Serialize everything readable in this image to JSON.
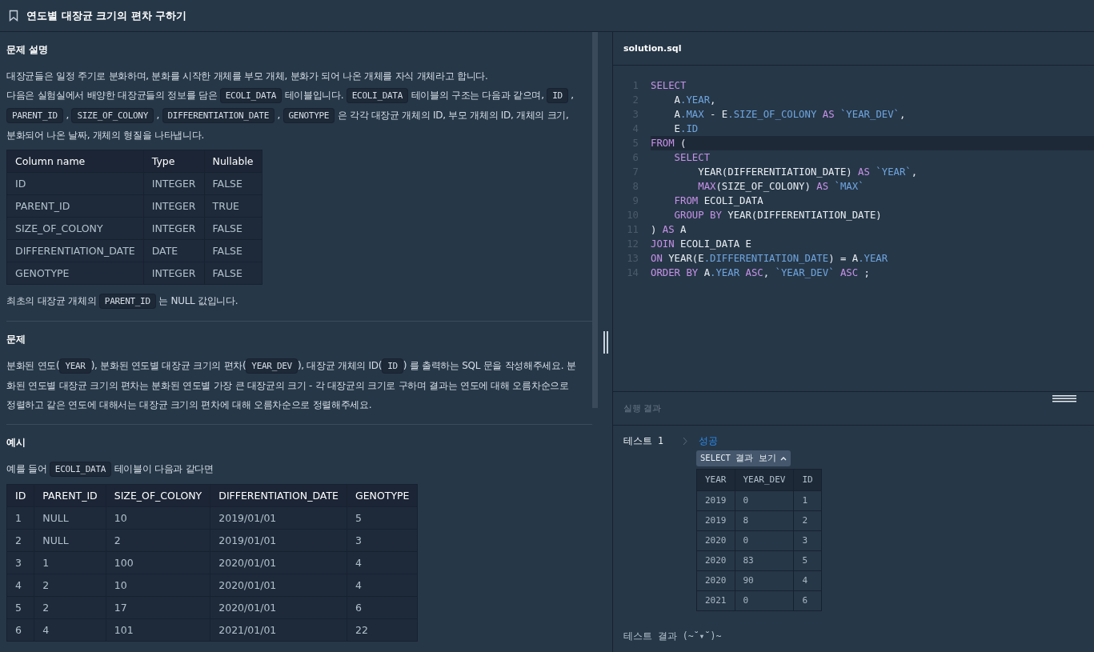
{
  "title": "연도별 대장균 크기의 편차 구하기",
  "description": {
    "heading": "문제 설명",
    "paragraphs": [
      [
        {
          "kind": "text",
          "t": "대장균들은 일정 주기로 분화하며, 분화를 시작한 개체를 부모 개체, 분화가 되어 나온 개체를 자식 개체라고 합니다."
        }
      ],
      [
        {
          "kind": "text",
          "t": "다음은 실험실에서 배양한 대장균들의 정보를 담은 "
        },
        {
          "kind": "code",
          "t": "ECOLI_DATA"
        },
        {
          "kind": "text",
          "t": " 테이블입니다. "
        },
        {
          "kind": "code",
          "t": "ECOLI_DATA"
        },
        {
          "kind": "text",
          "t": " 테이블의 구조는 다음과 같으며, "
        },
        {
          "kind": "code",
          "t": "ID"
        },
        {
          "kind": "text",
          "t": " , "
        },
        {
          "kind": "code",
          "t": "PARENT_ID"
        },
        {
          "kind": "text",
          "t": " , "
        },
        {
          "kind": "code",
          "t": "SIZE_OF_COLONY"
        },
        {
          "kind": "text",
          "t": " , "
        },
        {
          "kind": "code",
          "t": "DIFFERENTIATION_DATE"
        },
        {
          "kind": "text",
          "t": " , "
        },
        {
          "kind": "code",
          "t": "GENOTYPE"
        },
        {
          "kind": "text",
          "t": " 은 각각 대장균 개체의 ID, 부모 개체의 ID, 개체의 크기, 분화되어 나온 날짜, 개체의 형질을 나타냅니다."
        }
      ]
    ],
    "table": {
      "columns": [
        "Column name",
        "Type",
        "Nullable"
      ],
      "rows": [
        [
          "ID",
          "INTEGER",
          "FALSE"
        ],
        [
          "PARENT_ID",
          "INTEGER",
          "TRUE"
        ],
        [
          "SIZE_OF_COLONY",
          "INTEGER",
          "FALSE"
        ],
        [
          "DIFFERENTIATION_DATE",
          "DATE",
          "FALSE"
        ],
        [
          "GENOTYPE",
          "INTEGER",
          "FALSE"
        ]
      ]
    },
    "note": [
      {
        "kind": "text",
        "t": "최초의 대장균 개체의 "
      },
      {
        "kind": "code",
        "t": "PARENT_ID"
      },
      {
        "kind": "text",
        "t": " 는 NULL 값입니다."
      }
    ]
  },
  "problem": {
    "heading": "문제",
    "paragraph": [
      {
        "kind": "text",
        "t": "분화된 연도("
      },
      {
        "kind": "code",
        "t": "YEAR"
      },
      {
        "kind": "text",
        "t": "), 분화된 연도별 대장균 크기의 편차("
      },
      {
        "kind": "code",
        "t": "YEAR_DEV"
      },
      {
        "kind": "text",
        "t": "), 대장균 개체의 ID("
      },
      {
        "kind": "code",
        "t": "ID"
      },
      {
        "kind": "text",
        "t": ") 를 출력하는 SQL 문을 작성해주세요. 분화된 연도별 대장균 크기의 편차는 분화된 연도별 가장 큰 대장균의 크기 - 각 대장균의 크기로 구하며 결과는 연도에 대해 오름차순으로 정렬하고 같은 연도에 대해서는 대장균 크기의 편차에 대해 오름차순으로 정렬해주세요."
      }
    ]
  },
  "example": {
    "heading": "예시",
    "intro": [
      {
        "kind": "text",
        "t": "예를 들어 "
      },
      {
        "kind": "code",
        "t": "ECOLI_DATA"
      },
      {
        "kind": "text",
        "t": " 테이블이 다음과 같다면"
      }
    ],
    "table": {
      "columns": [
        "ID",
        "PARENT_ID",
        "SIZE_OF_COLONY",
        "DIFFERENTIATION_DATE",
        "GENOTYPE"
      ],
      "rows": [
        [
          "1",
          "NULL",
          "10",
          "2019/01/01",
          "5"
        ],
        [
          "2",
          "NULL",
          "2",
          "2019/01/01",
          "3"
        ],
        [
          "3",
          "1",
          "100",
          "2020/01/01",
          "4"
        ],
        [
          "4",
          "2",
          "10",
          "2020/01/01",
          "4"
        ],
        [
          "5",
          "2",
          "17",
          "2020/01/01",
          "6"
        ],
        [
          "6",
          "4",
          "101",
          "2021/01/01",
          "22"
        ]
      ]
    }
  },
  "editor": {
    "filename": "solution.sql",
    "lines": [
      {
        "n": "1",
        "selected": false,
        "tokens": [
          {
            "kind": "kw",
            "t": "SELECT"
          }
        ]
      },
      {
        "n": "2",
        "selected": false,
        "tokens": [
          {
            "kind": "id",
            "t": "    A"
          },
          {
            "kind": "prop",
            "t": ".YEAR"
          },
          {
            "kind": "id",
            "t": ","
          }
        ]
      },
      {
        "n": "3",
        "selected": false,
        "tokens": [
          {
            "kind": "id",
            "t": "    A"
          },
          {
            "kind": "prop",
            "t": ".MAX"
          },
          {
            "kind": "id",
            "t": " - E"
          },
          {
            "kind": "prop",
            "t": ".SIZE_OF_COLONY"
          },
          {
            "kind": "kw",
            "t": " AS"
          },
          {
            "kind": "prop",
            "t": " `YEAR_DEV`"
          },
          {
            "kind": "id",
            "t": ","
          }
        ]
      },
      {
        "n": "4",
        "selected": false,
        "tokens": [
          {
            "kind": "id",
            "t": "    E"
          },
          {
            "kind": "prop",
            "t": ".ID"
          }
        ]
      },
      {
        "n": "5",
        "selected": true,
        "tokens": [
          {
            "kind": "kw",
            "t": "FROM"
          },
          {
            "kind": "id",
            "t": " ("
          }
        ]
      },
      {
        "n": "6",
        "selected": false,
        "tokens": [
          {
            "kind": "kw",
            "t": "    SELECT"
          }
        ]
      },
      {
        "n": "7",
        "selected": false,
        "tokens": [
          {
            "kind": "id",
            "t": "        YEAR(DIFFERENTIATION_DATE)"
          },
          {
            "kind": "kw",
            "t": " AS"
          },
          {
            "kind": "prop",
            "t": " `YEAR`"
          },
          {
            "kind": "id",
            "t": ","
          }
        ]
      },
      {
        "n": "8",
        "selected": false,
        "tokens": [
          {
            "kind": "kw",
            "t": "        MAX"
          },
          {
            "kind": "id",
            "t": "(SIZE_OF_COLONY)"
          },
          {
            "kind": "kw",
            "t": " AS"
          },
          {
            "kind": "prop",
            "t": " `MAX`"
          }
        ]
      },
      {
        "n": "9",
        "selected": false,
        "tokens": [
          {
            "kind": "kw",
            "t": "    FROM"
          },
          {
            "kind": "id",
            "t": " ECOLI_DATA"
          }
        ]
      },
      {
        "n": "10",
        "selected": false,
        "tokens": [
          {
            "kind": "kw",
            "t": "    GROUP BY"
          },
          {
            "kind": "id",
            "t": " YEAR(DIFFERENTIATION_DATE)"
          }
        ]
      },
      {
        "n": "11",
        "selected": false,
        "tokens": [
          {
            "kind": "id",
            "t": ")"
          },
          {
            "kind": "kw",
            "t": " AS"
          },
          {
            "kind": "id",
            "t": " A"
          }
        ]
      },
      {
        "n": "12",
        "selected": false,
        "tokens": [
          {
            "kind": "kw",
            "t": "JOIN"
          },
          {
            "kind": "id",
            "t": " ECOLI_DATA E"
          }
        ]
      },
      {
        "n": "13",
        "selected": false,
        "tokens": [
          {
            "kind": "kw",
            "t": "ON"
          },
          {
            "kind": "id",
            "t": " YEAR(E"
          },
          {
            "kind": "prop",
            "t": ".DIFFERENTIATION_DATE"
          },
          {
            "kind": "id",
            "t": ") = A"
          },
          {
            "kind": "prop",
            "t": ".YEAR"
          }
        ]
      },
      {
        "n": "14",
        "selected": false,
        "tokens": [
          {
            "kind": "kw",
            "t": "ORDER BY"
          },
          {
            "kind": "id",
            "t": " A"
          },
          {
            "kind": "prop",
            "t": ".YEAR"
          },
          {
            "kind": "kw",
            "t": " ASC"
          },
          {
            "kind": "id",
            "t": ","
          },
          {
            "kind": "prop",
            "t": " `YEAR_DEV`"
          },
          {
            "kind": "kw",
            "t": " ASC"
          },
          {
            "kind": "id",
            "t": " ;"
          }
        ]
      }
    ]
  },
  "results": {
    "heading": "실행 결과",
    "test_label": "테스트 1",
    "status": "성공",
    "toggle": "SELECT 결과 보기",
    "table": {
      "columns": [
        "YEAR",
        "YEAR_DEV",
        "ID"
      ],
      "rows": [
        [
          "2019",
          "0",
          "1"
        ],
        [
          "2019",
          "8",
          "2"
        ],
        [
          "2020",
          "0",
          "3"
        ],
        [
          "2020",
          "83",
          "5"
        ],
        [
          "2020",
          "90",
          "4"
        ],
        [
          "2021",
          "0",
          "6"
        ]
      ]
    },
    "footer": "테스트 결과 (~˘▾˘)~"
  }
}
